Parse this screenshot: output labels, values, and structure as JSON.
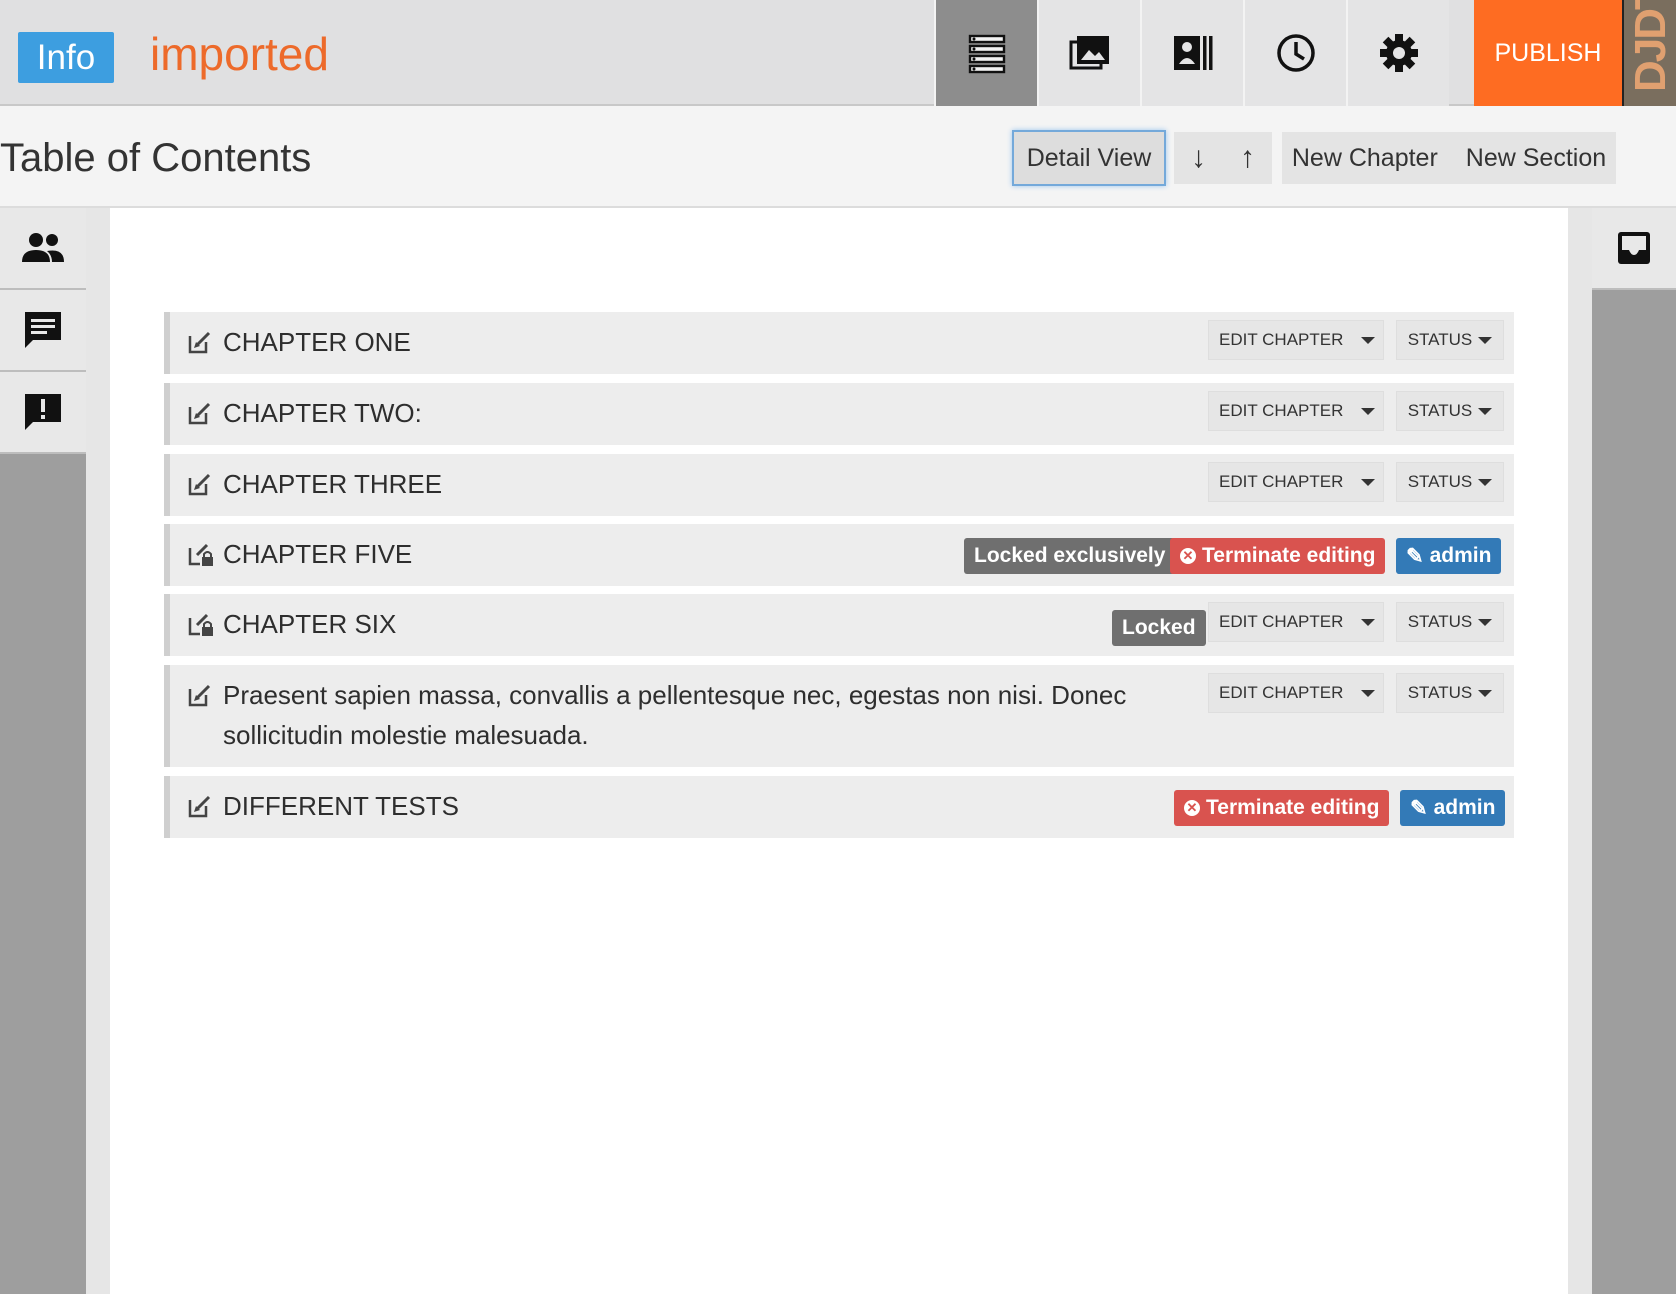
{
  "topbar": {
    "info_label": "Info",
    "book_title": "imported",
    "tools": [
      "toc-icon",
      "images-icon",
      "bibliography-icon",
      "history-icon",
      "gear-icon"
    ],
    "publish_label": "PUBLISH",
    "logo_text": "DJDT",
    "accent_color": "#fe6c22",
    "info_color": "#3d9ee0"
  },
  "toc": {
    "title": "Table of Contents",
    "detail_view": "Detail View",
    "move_down": "↓",
    "move_up": "↑",
    "new_chapter": "New Chapter",
    "new_section": "New Section"
  },
  "left_rail": [
    "users-icon",
    "comment-icon",
    "alert-comment-icon"
  ],
  "right_rail": [
    "inbox-icon"
  ],
  "chapters": [
    {
      "title": "CHAPTER ONE",
      "edit_label": "EDIT CHAPTER",
      "status_label": "STATUS"
    },
    {
      "title": "CHAPTER TWO:",
      "edit_label": "EDIT CHAPTER",
      "status_label": "STATUS"
    },
    {
      "title": "CHAPTER THREE",
      "edit_label": "EDIT CHAPTER",
      "status_label": "STATUS"
    },
    {
      "title": "CHAPTER FIVE",
      "locked_label": "Locked exclusively",
      "terminate_label": "Terminate editing",
      "user_label": "admin"
    },
    {
      "title": "CHAPTER SIX",
      "locked_label": "Locked",
      "edit_label": "EDIT CHAPTER",
      "status_label": "STATUS"
    },
    {
      "title": "Praesent sapien massa, convallis a pellentesque nec, egestas non nisi. Donec sollicitudin molestie malesuada.",
      "edit_label": "EDIT CHAPTER",
      "status_label": "STATUS"
    },
    {
      "title": "DIFFERENT TESTS",
      "terminate_label": "Terminate editing",
      "user_label": "admin"
    }
  ]
}
